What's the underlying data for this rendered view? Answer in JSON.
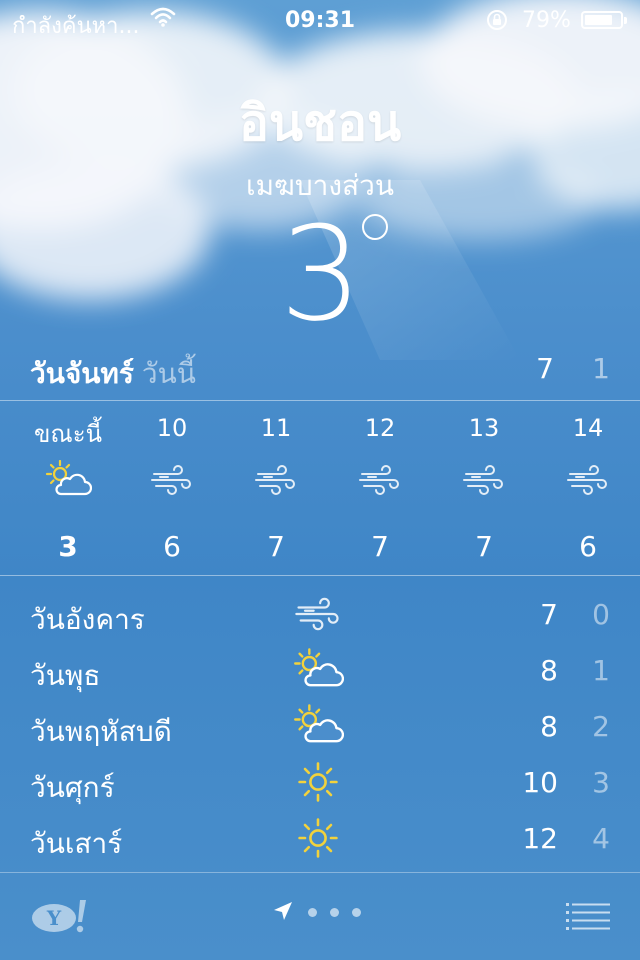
{
  "status_bar": {
    "carrier": "กำลังค้นหา...",
    "time": "09:31",
    "battery_text": "79%",
    "battery_level": 0.79,
    "icons": [
      "wifi-icon",
      "rotation-lock-icon",
      "battery-icon"
    ]
  },
  "current": {
    "city": "อินชอน",
    "condition": "เมฆบางส่วน",
    "temperature": "3"
  },
  "today": {
    "day": "วันจันทร์",
    "label": "วันนี้",
    "high": "7",
    "low": "1"
  },
  "hourly": [
    {
      "time": "ขณะนี้",
      "icon": "partly-cloudy-icon",
      "temp": "3"
    },
    {
      "time": "10",
      "icon": "wind-icon",
      "temp": "6"
    },
    {
      "time": "11",
      "icon": "wind-icon",
      "temp": "7"
    },
    {
      "time": "12",
      "icon": "wind-icon",
      "temp": "7"
    },
    {
      "time": "13",
      "icon": "wind-icon",
      "temp": "7"
    },
    {
      "time": "14",
      "icon": "wind-icon",
      "temp": "6"
    }
  ],
  "daily": [
    {
      "day": "วันอังคาร",
      "icon": "wind-icon",
      "high": "7",
      "low": "0"
    },
    {
      "day": "วันพุธ",
      "icon": "partly-cloudy-icon",
      "high": "8",
      "low": "1"
    },
    {
      "day": "วันพฤหัสบดี",
      "icon": "partly-cloudy-icon",
      "high": "8",
      "low": "2"
    },
    {
      "day": "วันศุกร์",
      "icon": "sun-icon",
      "high": "10",
      "low": "3"
    },
    {
      "day": "วันเสาร์",
      "icon": "sun-icon",
      "high": "12",
      "low": "4"
    }
  ],
  "footer": {
    "icons": [
      "yahoo-logo-icon",
      "location-arrow-icon",
      "list-icon"
    ],
    "page_count": 3
  },
  "colors": {
    "sky_top": "#5e9fd4",
    "sky_bottom": "#3f86c7",
    "sun": "#f2d23c"
  }
}
